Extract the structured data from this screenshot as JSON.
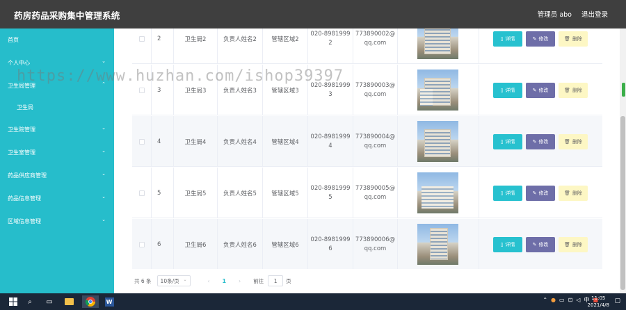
{
  "header": {
    "title": "药房药品采购集中管理系统",
    "user": "管理员 abo",
    "logout": "退出登录"
  },
  "sidebar": {
    "items": [
      {
        "label": "首页",
        "chevron": false
      },
      {
        "label": "个人中心",
        "chevron": true
      },
      {
        "label": "卫生局管理",
        "chevron": true
      },
      {
        "label": "卫生局",
        "chevron": false,
        "sub": true
      },
      {
        "label": "卫生院管理",
        "chevron": true
      },
      {
        "label": "卫生室管理",
        "chevron": true
      },
      {
        "label": "药品供应商管理",
        "chevron": true
      },
      {
        "label": "药品信息管理",
        "chevron": true
      },
      {
        "label": "区域信息管理",
        "chevron": true
      }
    ]
  },
  "table": {
    "rows": [
      {
        "idx": "2",
        "name": "卫生局2",
        "person": "负责人姓名2",
        "area": "管辖区域2",
        "phone1": "020-8981999",
        "phone2": "2",
        "mail1": "773890002@",
        "mail2": "qq.com"
      },
      {
        "idx": "3",
        "name": "卫生局3",
        "person": "负责人姓名3",
        "area": "管辖区域3",
        "phone1": "020-8981999",
        "phone2": "3",
        "mail1": "773890003@",
        "mail2": "qq.com"
      },
      {
        "idx": "4",
        "name": "卫生局4",
        "person": "负责人姓名4",
        "area": "管辖区域4",
        "phone1": "020-8981999",
        "phone2": "4",
        "mail1": "773890004@",
        "mail2": "qq.com"
      },
      {
        "idx": "5",
        "name": "卫生局5",
        "person": "负责人姓名5",
        "area": "管辖区域5",
        "phone1": "020-8981999",
        "phone2": "5",
        "mail1": "773890005@",
        "mail2": "qq.com"
      },
      {
        "idx": "6",
        "name": "卫生局6",
        "person": "负责人姓名6",
        "area": "管辖区域6",
        "phone1": "020-8981999",
        "phone2": "6",
        "mail1": "773890006@",
        "mail2": "qq.com"
      }
    ],
    "actions": {
      "detail": "详情",
      "edit": "修改",
      "delete": "删除"
    }
  },
  "pager": {
    "total": "共 6 条",
    "size": "10条/页",
    "prev": "‹",
    "current": "1",
    "next": "›",
    "goto": "前往",
    "goto_value": "1",
    "page_unit": "页"
  },
  "watermark": "https://www.huzhan.com/ishop39397",
  "taskbar": {
    "time": "11:05",
    "date": "2021/4/8",
    "ime": "中"
  },
  "colors": {
    "sidebar": "#26bdcb",
    "header": "#3f3f3f",
    "detail": "#27c1cf",
    "edit": "#6e6ea8",
    "delete": "#fdf7c4"
  }
}
